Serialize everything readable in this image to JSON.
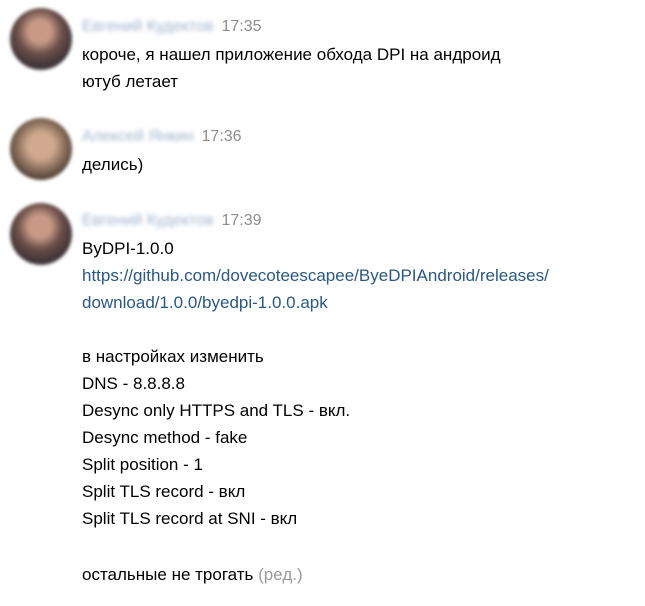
{
  "messages": [
    {
      "author": "Евгений Кудектов",
      "time": "17:35",
      "lines": [
        "короче, я нашел приложение обхода DPI на андроид",
        "ютуб летает"
      ]
    },
    {
      "author": "Алексей Янкин",
      "time": "17:36",
      "lines": [
        "делись)"
      ]
    },
    {
      "author": "Евгений Кудектов",
      "time": "17:39",
      "title": "ByDPI-1.0.0",
      "link_lines": [
        "https://github.com/dovecoteescapee/ByeDPIAndroid/releases/",
        "download/1.0.0/byedpi-1.0.0.apk"
      ],
      "settings": [
        "в настройках изменить",
        "DNS - 8.8.8.8",
        "Desync only HTTPS and TLS - вкл.",
        "Desync method - fake",
        "Split position - 1",
        "Split TLS record - вкл",
        "Split TLS record at SNI - вкл"
      ],
      "footer": "остальные не трогать",
      "edited_label": "(ред.)"
    }
  ]
}
